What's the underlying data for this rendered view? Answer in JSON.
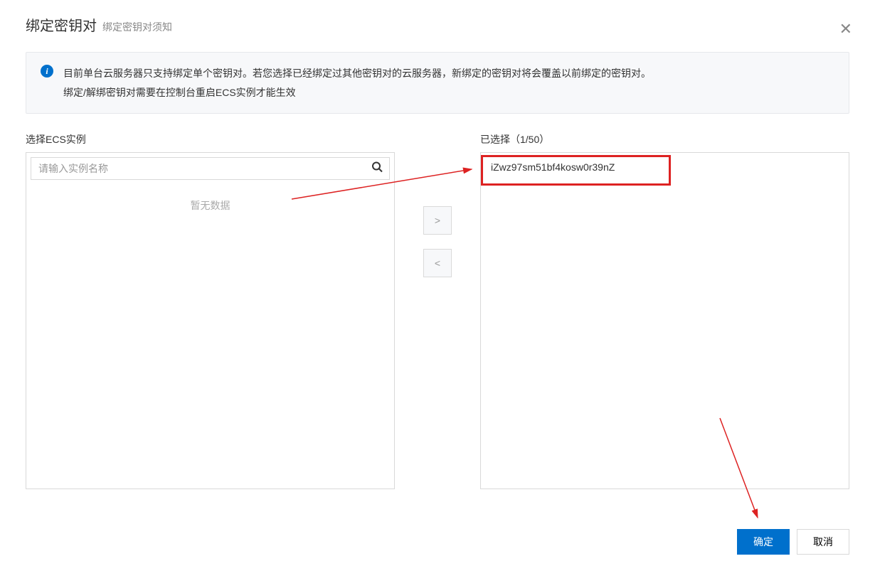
{
  "header": {
    "title": "绑定密钥对",
    "subtitle": "绑定密钥对须知"
  },
  "info": {
    "line1": "目前单台云服务器只支持绑定单个密钥对。若您选择已经绑定过其他密钥对的云服务器，新绑定的密钥对将会覆盖以前绑定的密钥对。",
    "line2": "绑定/解绑密钥对需要在控制台重启ECS实例才能生效"
  },
  "left_panel": {
    "label": "选择ECS实例",
    "search_placeholder": "请输入实例名称",
    "empty": "暂无数据"
  },
  "right_panel": {
    "label": "已选择（1/50）",
    "items": [
      {
        "name": "iZwz97sm51bf4kosw0r39nZ"
      }
    ]
  },
  "controls": {
    "add": ">",
    "remove": "<"
  },
  "footer": {
    "confirm": "确定",
    "cancel": "取消"
  },
  "close_glyph": "✕"
}
